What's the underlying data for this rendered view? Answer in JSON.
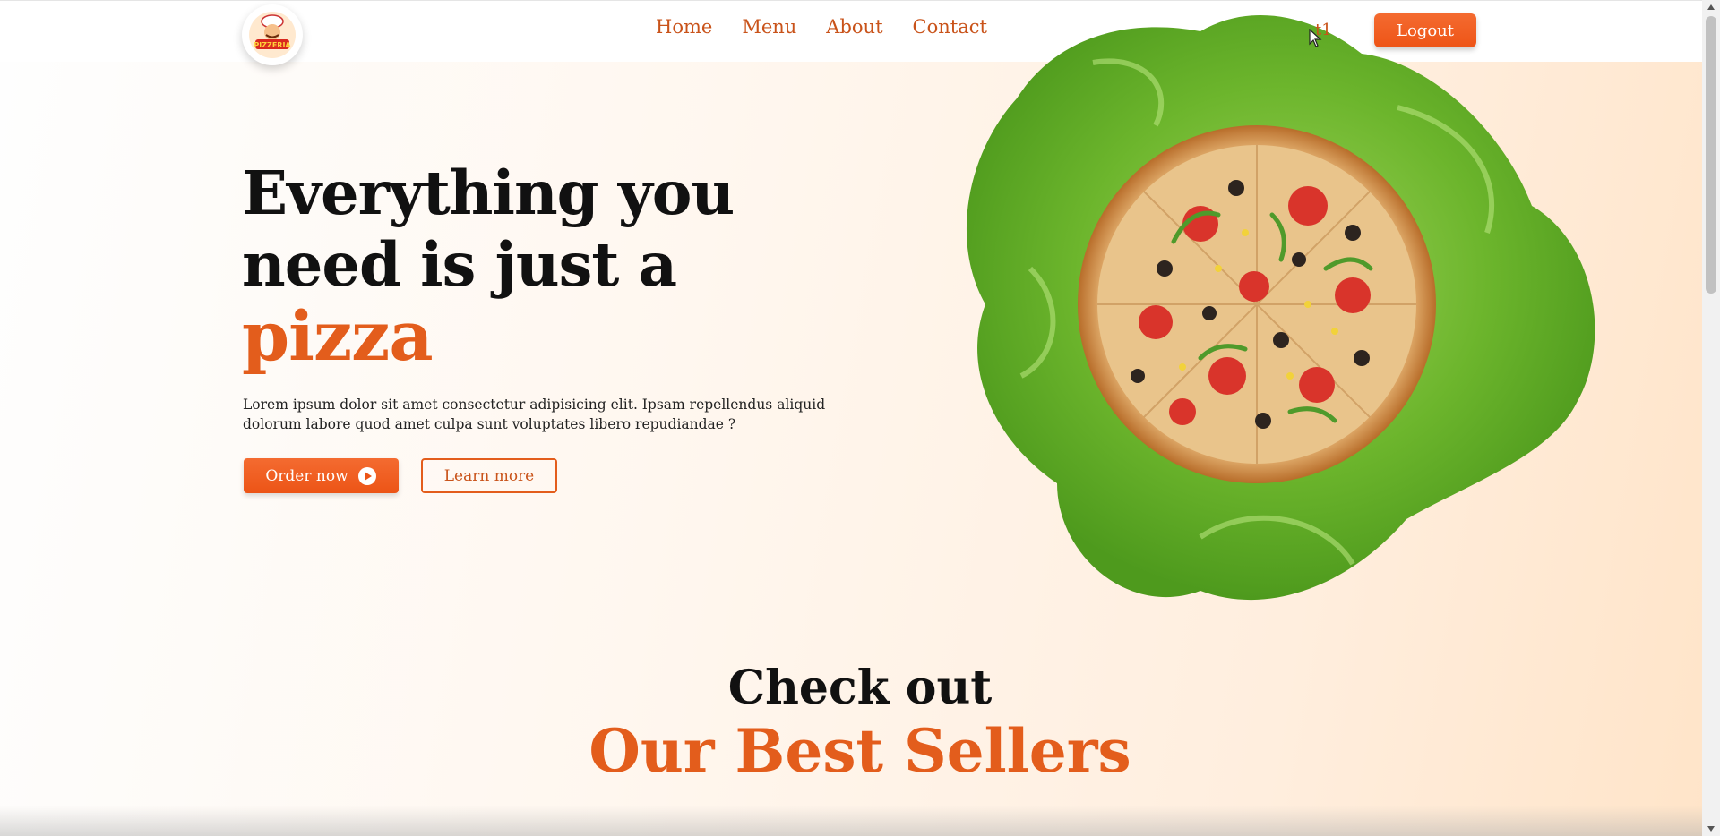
{
  "header": {
    "logo_alt": "Pizzeria",
    "nav": [
      "Home",
      "Menu",
      "About",
      "Contact"
    ],
    "user_name": "t1",
    "logout_label": "Logout"
  },
  "hero": {
    "title_line1": "Everything you",
    "title_line2": "need is just a",
    "title_accent": "pizza",
    "description": "Lorem ipsum dolor sit amet consectetur adipisicing elit. Ipsam repellendus aliquid dolorum labore quod amet culpa sunt voluptates libero repudiandae ?",
    "order_label": "Order now",
    "learn_label": "Learn more"
  },
  "best_sellers": {
    "subtitle": "Check out",
    "title": "Our Best Sellers"
  },
  "colors": {
    "accent": "#e35d1c",
    "nav_text": "#c9531a",
    "button": "#f05e1f"
  },
  "icons": [
    "pizzeria-logo-icon",
    "play-circle-icon",
    "pizza-image",
    "cursor-icon"
  ]
}
